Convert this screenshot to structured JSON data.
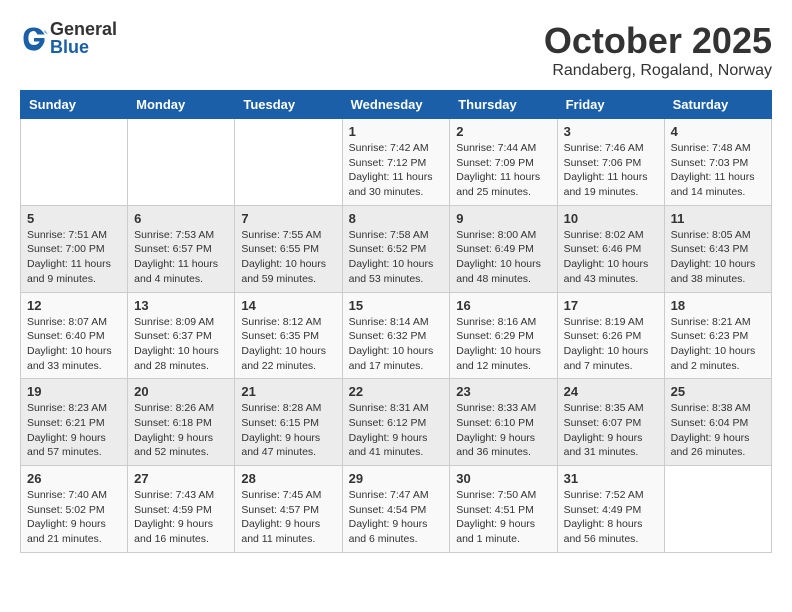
{
  "logo": {
    "general": "General",
    "blue": "Blue"
  },
  "title": "October 2025",
  "location": "Randaberg, Rogaland, Norway",
  "weekdays": [
    "Sunday",
    "Monday",
    "Tuesday",
    "Wednesday",
    "Thursday",
    "Friday",
    "Saturday"
  ],
  "weeks": [
    [
      {
        "day": "",
        "info": ""
      },
      {
        "day": "",
        "info": ""
      },
      {
        "day": "",
        "info": ""
      },
      {
        "day": "1",
        "info": "Sunrise: 7:42 AM\nSunset: 7:12 PM\nDaylight: 11 hours\nand 30 minutes."
      },
      {
        "day": "2",
        "info": "Sunrise: 7:44 AM\nSunset: 7:09 PM\nDaylight: 11 hours\nand 25 minutes."
      },
      {
        "day": "3",
        "info": "Sunrise: 7:46 AM\nSunset: 7:06 PM\nDaylight: 11 hours\nand 19 minutes."
      },
      {
        "day": "4",
        "info": "Sunrise: 7:48 AM\nSunset: 7:03 PM\nDaylight: 11 hours\nand 14 minutes."
      }
    ],
    [
      {
        "day": "5",
        "info": "Sunrise: 7:51 AM\nSunset: 7:00 PM\nDaylight: 11 hours\nand 9 minutes."
      },
      {
        "day": "6",
        "info": "Sunrise: 7:53 AM\nSunset: 6:57 PM\nDaylight: 11 hours\nand 4 minutes."
      },
      {
        "day": "7",
        "info": "Sunrise: 7:55 AM\nSunset: 6:55 PM\nDaylight: 10 hours\nand 59 minutes."
      },
      {
        "day": "8",
        "info": "Sunrise: 7:58 AM\nSunset: 6:52 PM\nDaylight: 10 hours\nand 53 minutes."
      },
      {
        "day": "9",
        "info": "Sunrise: 8:00 AM\nSunset: 6:49 PM\nDaylight: 10 hours\nand 48 minutes."
      },
      {
        "day": "10",
        "info": "Sunrise: 8:02 AM\nSunset: 6:46 PM\nDaylight: 10 hours\nand 43 minutes."
      },
      {
        "day": "11",
        "info": "Sunrise: 8:05 AM\nSunset: 6:43 PM\nDaylight: 10 hours\nand 38 minutes."
      }
    ],
    [
      {
        "day": "12",
        "info": "Sunrise: 8:07 AM\nSunset: 6:40 PM\nDaylight: 10 hours\nand 33 minutes."
      },
      {
        "day": "13",
        "info": "Sunrise: 8:09 AM\nSunset: 6:37 PM\nDaylight: 10 hours\nand 28 minutes."
      },
      {
        "day": "14",
        "info": "Sunrise: 8:12 AM\nSunset: 6:35 PM\nDaylight: 10 hours\nand 22 minutes."
      },
      {
        "day": "15",
        "info": "Sunrise: 8:14 AM\nSunset: 6:32 PM\nDaylight: 10 hours\nand 17 minutes."
      },
      {
        "day": "16",
        "info": "Sunrise: 8:16 AM\nSunset: 6:29 PM\nDaylight: 10 hours\nand 12 minutes."
      },
      {
        "day": "17",
        "info": "Sunrise: 8:19 AM\nSunset: 6:26 PM\nDaylight: 10 hours\nand 7 minutes."
      },
      {
        "day": "18",
        "info": "Sunrise: 8:21 AM\nSunset: 6:23 PM\nDaylight: 10 hours\nand 2 minutes."
      }
    ],
    [
      {
        "day": "19",
        "info": "Sunrise: 8:23 AM\nSunset: 6:21 PM\nDaylight: 9 hours\nand 57 minutes."
      },
      {
        "day": "20",
        "info": "Sunrise: 8:26 AM\nSunset: 6:18 PM\nDaylight: 9 hours\nand 52 minutes."
      },
      {
        "day": "21",
        "info": "Sunrise: 8:28 AM\nSunset: 6:15 PM\nDaylight: 9 hours\nand 47 minutes."
      },
      {
        "day": "22",
        "info": "Sunrise: 8:31 AM\nSunset: 6:12 PM\nDaylight: 9 hours\nand 41 minutes."
      },
      {
        "day": "23",
        "info": "Sunrise: 8:33 AM\nSunset: 6:10 PM\nDaylight: 9 hours\nand 36 minutes."
      },
      {
        "day": "24",
        "info": "Sunrise: 8:35 AM\nSunset: 6:07 PM\nDaylight: 9 hours\nand 31 minutes."
      },
      {
        "day": "25",
        "info": "Sunrise: 8:38 AM\nSunset: 6:04 PM\nDaylight: 9 hours\nand 26 minutes."
      }
    ],
    [
      {
        "day": "26",
        "info": "Sunrise: 7:40 AM\nSunset: 5:02 PM\nDaylight: 9 hours\nand 21 minutes."
      },
      {
        "day": "27",
        "info": "Sunrise: 7:43 AM\nSunset: 4:59 PM\nDaylight: 9 hours\nand 16 minutes."
      },
      {
        "day": "28",
        "info": "Sunrise: 7:45 AM\nSunset: 4:57 PM\nDaylight: 9 hours\nand 11 minutes."
      },
      {
        "day": "29",
        "info": "Sunrise: 7:47 AM\nSunset: 4:54 PM\nDaylight: 9 hours\nand 6 minutes."
      },
      {
        "day": "30",
        "info": "Sunrise: 7:50 AM\nSunset: 4:51 PM\nDaylight: 9 hours\nand 1 minute."
      },
      {
        "day": "31",
        "info": "Sunrise: 7:52 AM\nSunset: 4:49 PM\nDaylight: 8 hours\nand 56 minutes."
      },
      {
        "day": "",
        "info": ""
      }
    ]
  ]
}
